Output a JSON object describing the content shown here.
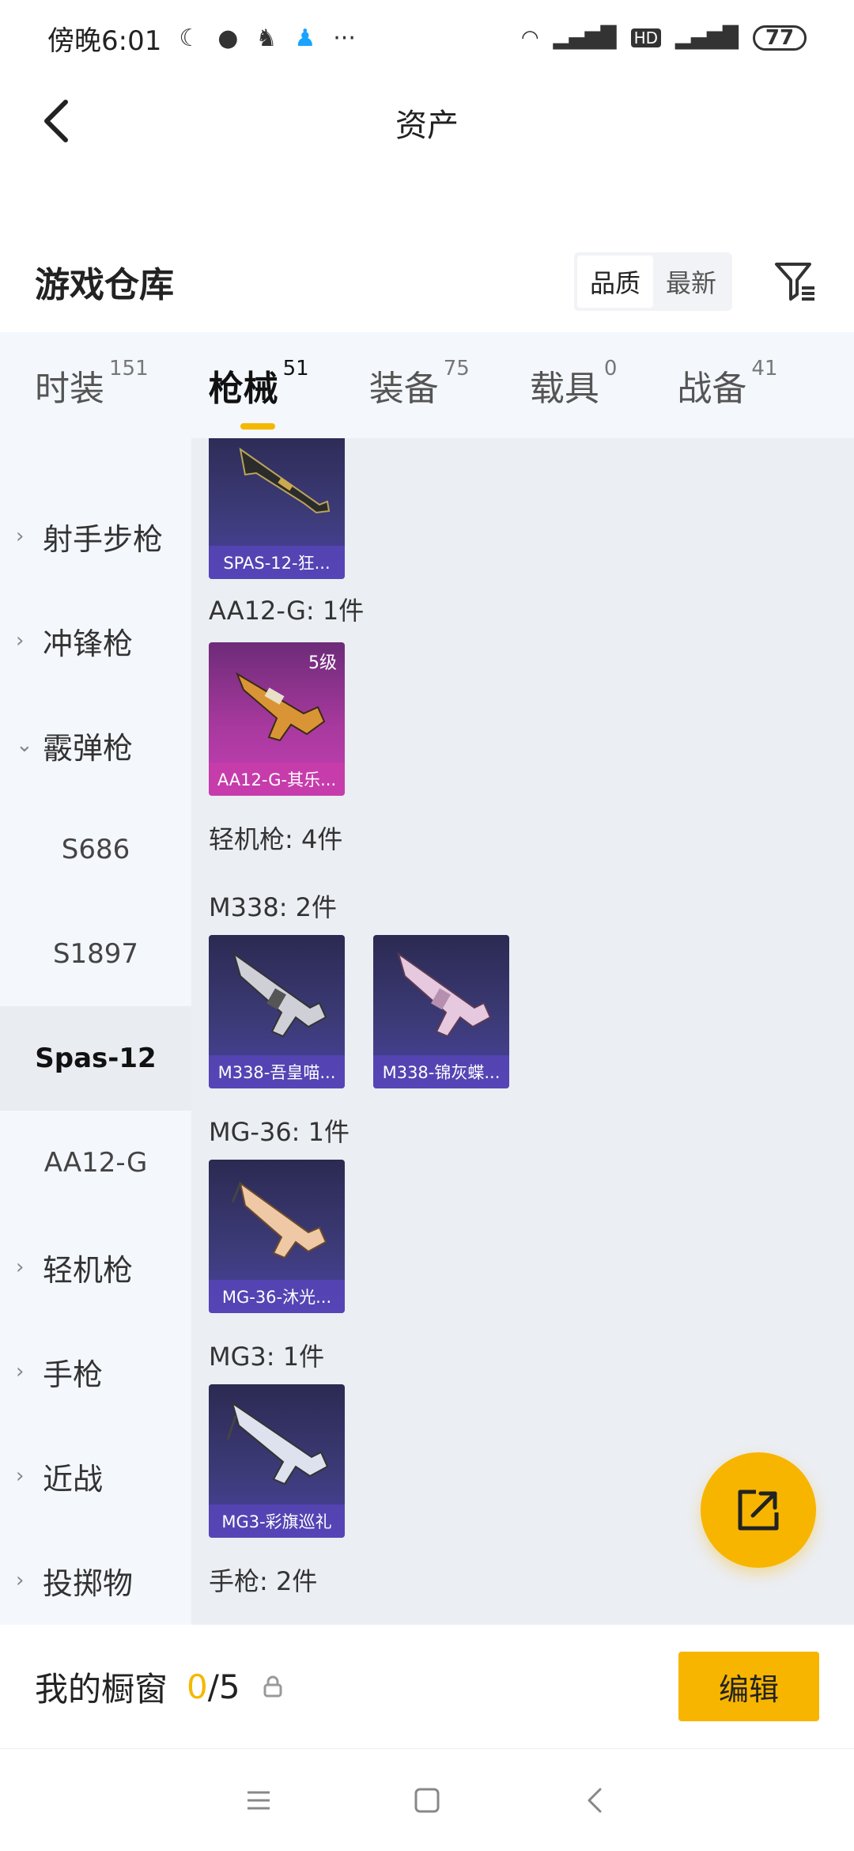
{
  "status": {
    "time": "傍晚6:01",
    "battery": "77"
  },
  "header": {
    "title": "资产"
  },
  "warehouse": {
    "title": "游戏仓库",
    "sort_options": [
      "品质",
      "最新"
    ]
  },
  "tabs": [
    {
      "label": "时装",
      "count": "151"
    },
    {
      "label": "枪械",
      "count": "51"
    },
    {
      "label": "装备",
      "count": "75"
    },
    {
      "label": "载具",
      "count": "0"
    },
    {
      "label": "战备",
      "count": "41"
    }
  ],
  "sidebar": [
    {
      "label": "射手步枪"
    },
    {
      "label": "冲锋枪"
    },
    {
      "label": "霰弹枪"
    },
    {
      "label": "S686"
    },
    {
      "label": "S1897"
    },
    {
      "label": "Spas-12"
    },
    {
      "label": "AA12-G"
    },
    {
      "label": "轻机枪"
    },
    {
      "label": "手枪"
    },
    {
      "label": "近战"
    },
    {
      "label": "投掷物"
    }
  ],
  "content": {
    "cards": [
      {
        "name": "SPAS-12-狂...",
        "level": ""
      },
      {
        "name": "AA12-G-其乐...",
        "level": "5级"
      },
      {
        "name": "M338-吾皇喵...",
        "level": ""
      },
      {
        "name": "M338-锦灰蝶...",
        "level": ""
      },
      {
        "name": "MG-36-沐光...",
        "level": ""
      },
      {
        "name": "MG3-彩旗巡礼",
        "level": ""
      }
    ],
    "groups": [
      {
        "label": "AA12-G: 1件"
      },
      {
        "label": "轻机枪: 4件"
      },
      {
        "label": "M338: 2件"
      },
      {
        "label": "MG-36: 1件"
      },
      {
        "label": "MG3: 1件"
      },
      {
        "label": "手枪: 2件"
      }
    ]
  },
  "bottom": {
    "window_label": "我的橱窗",
    "current": "0",
    "separator": "/",
    "max": "5",
    "edit_label": "编辑"
  },
  "colors": {
    "accent": "#f7b500",
    "sidebar_bg": "#f4f7fc",
    "content_bg": "#ebeef3"
  }
}
